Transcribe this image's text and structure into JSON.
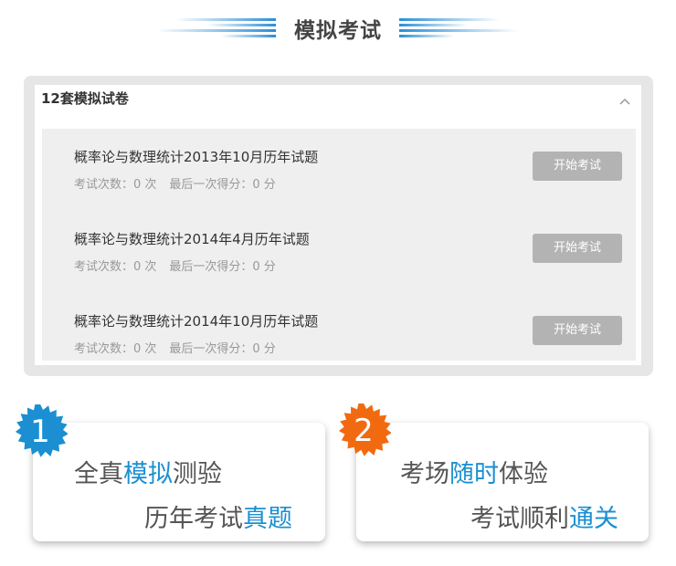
{
  "header": {
    "title": "模拟考试"
  },
  "colors": {
    "accent_blue": "#1b8fd2",
    "badge_blue": "#1b8fd2",
    "badge_orange": "#f26a10",
    "button_gray": "#b3b3b3"
  },
  "panel": {
    "heading": "12套模拟试卷",
    "collapse_icon": "chevron-up-icon",
    "items": [
      {
        "title": "概率论与数理统计2013年10月历年试题",
        "attempts": "考试次数：0 次",
        "last_score": "最后一次得分：0 分",
        "button": "开始考试"
      },
      {
        "title": "概率论与数理统计2014年4月历年试题",
        "attempts": "考试次数：0 次",
        "last_score": "最后一次得分：0 分",
        "button": "开始考试"
      },
      {
        "title": "概率论与数理统计2014年10月历年试题",
        "attempts": "考试次数：0 次",
        "last_score": "最后一次得分：0 分",
        "button": "开始考试"
      }
    ]
  },
  "features": [
    {
      "number": "1",
      "line1": {
        "pre": "全真",
        "hl": "模拟",
        "post": "测验"
      },
      "line2": {
        "pre": "历年考试",
        "hl": "真题",
        "post": ""
      }
    },
    {
      "number": "2",
      "line1": {
        "pre": "考场",
        "hl": "随时",
        "post": "体验"
      },
      "line2": {
        "pre": "考试顺利",
        "hl": "通关",
        "post": ""
      }
    }
  ]
}
